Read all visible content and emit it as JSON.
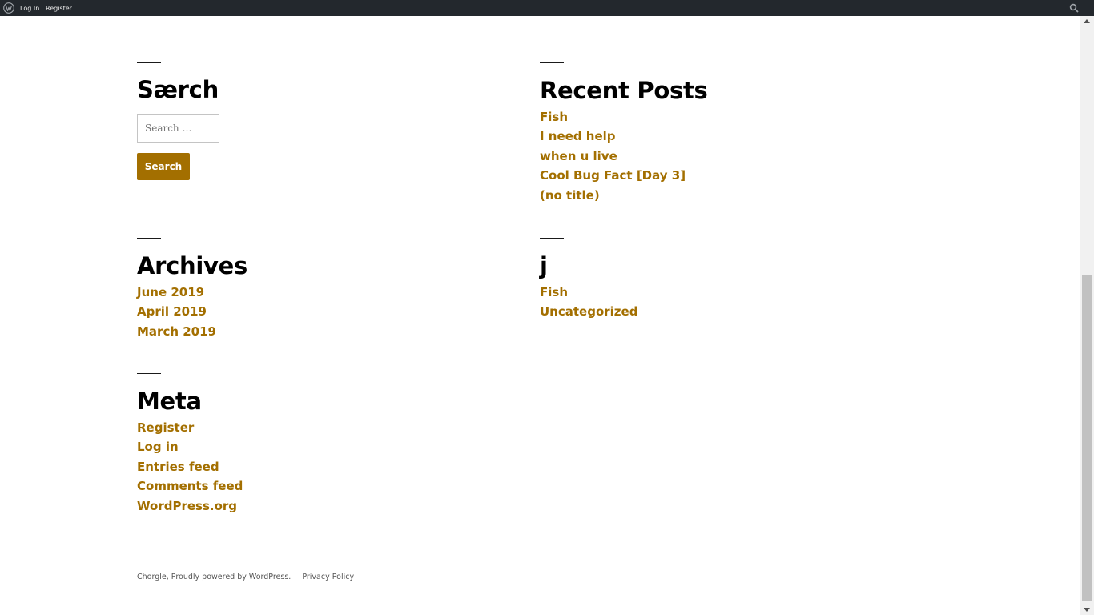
{
  "admin_bar": {
    "login_label": "Log In",
    "register_label": "Register"
  },
  "search_widget": {
    "title": "Særch",
    "placeholder": "Search …",
    "button_label": "Search"
  },
  "recent_posts": {
    "title": "Recent Posts",
    "items": [
      "Fish",
      "I need help",
      "when u live",
      "Cool Bug Fact [Day 3]",
      "(no title)"
    ]
  },
  "archives": {
    "title": "Archives",
    "items": [
      "June 2019",
      "April 2019",
      "March 2019"
    ]
  },
  "categories": {
    "title": "j",
    "items": [
      "Fish",
      "Uncategorized"
    ]
  },
  "meta": {
    "title": "Meta",
    "items": [
      "Register",
      "Log in",
      "Entries feed",
      "Comments feed",
      "WordPress.org"
    ]
  },
  "footer": {
    "credit": "Chorgle, Proudly powered by WordPress.",
    "privacy_label": "Privacy Policy"
  },
  "colors": {
    "admin_bar_bg": "#23282d",
    "link_accent": "#a36f00",
    "heading": "#000000",
    "background": "#ffffff"
  },
  "icons": {
    "admin_logo": "wordpress-logo-icon",
    "admin_search": "search-icon"
  }
}
